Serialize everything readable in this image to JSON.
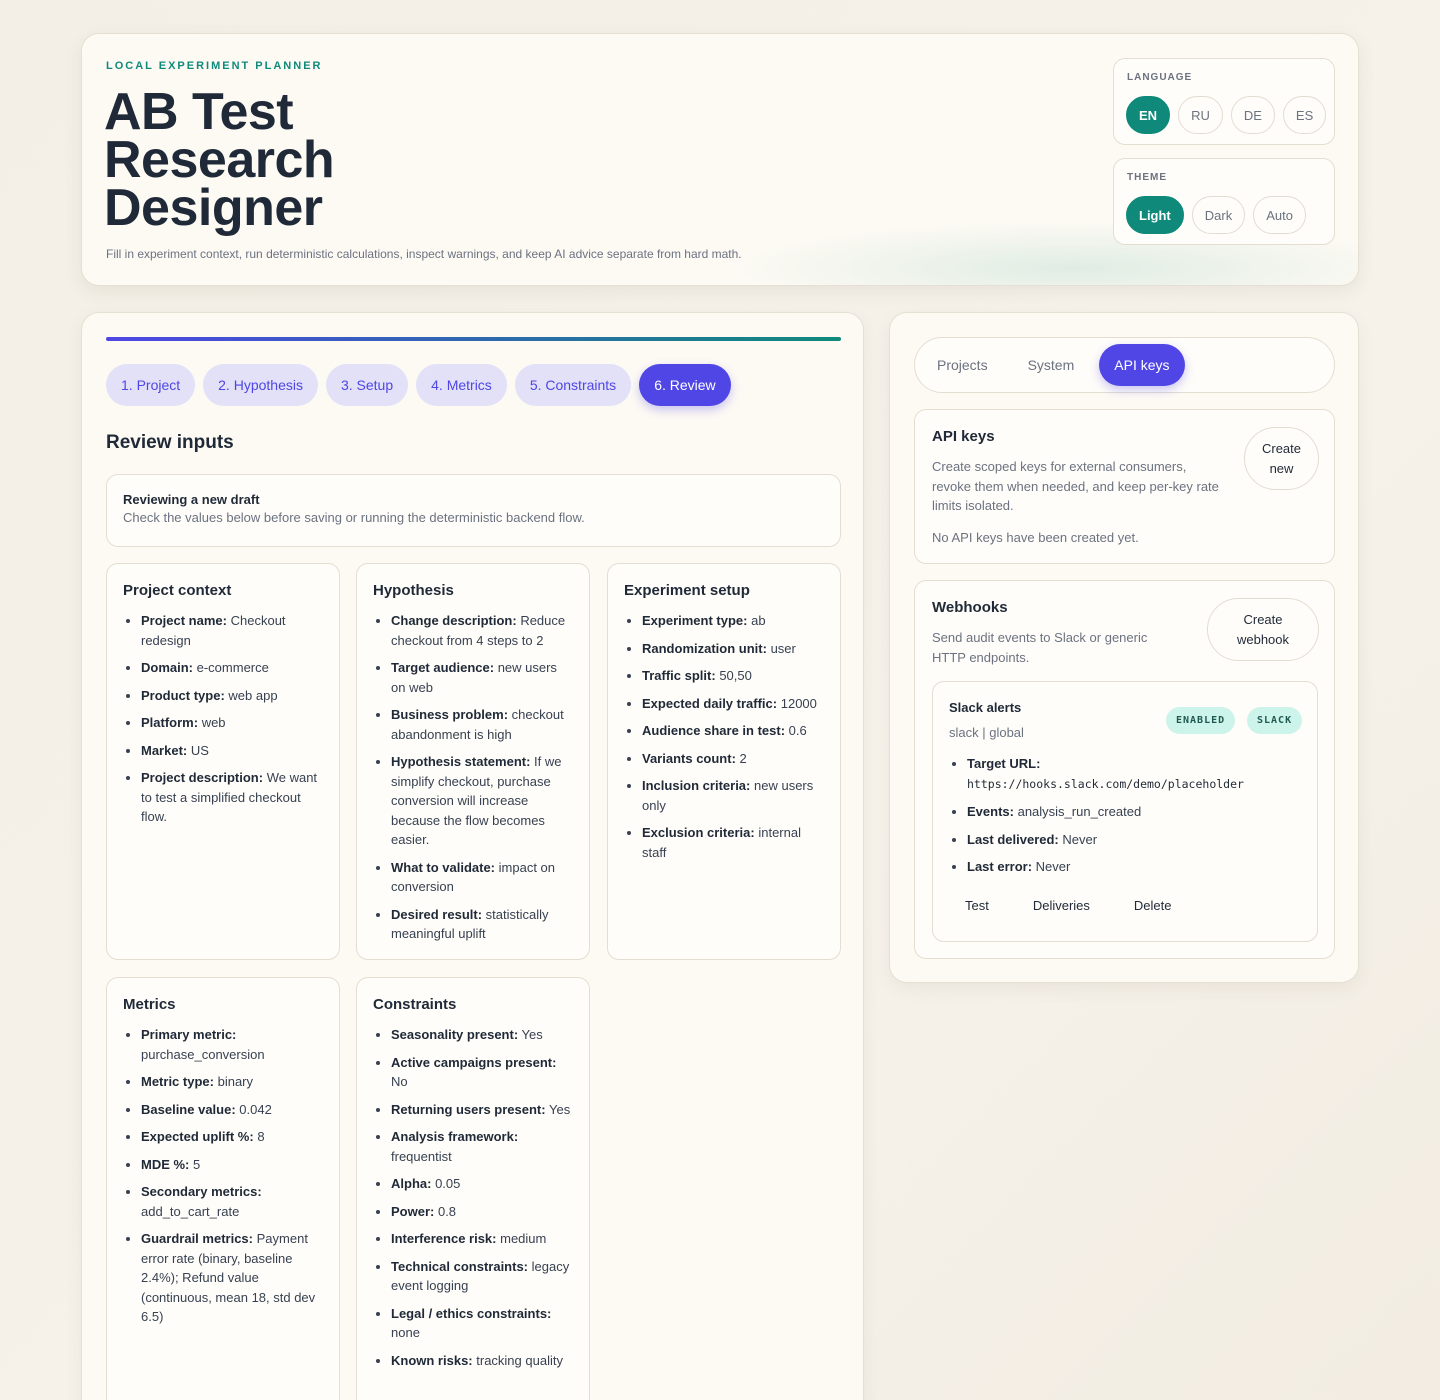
{
  "header": {
    "eyebrow": "LOCAL EXPERIMENT PLANNER",
    "title": "AB Test Research Designer",
    "subtitle": "Fill in experiment context, run deterministic calculations, inspect warnings, and keep AI advice separate from hard math."
  },
  "language": {
    "label": "LANGUAGE",
    "options": [
      "EN",
      "RU",
      "DE",
      "ES"
    ],
    "selected": "EN"
  },
  "theme": {
    "label": "THEME",
    "options": [
      "Light",
      "Dark",
      "Auto"
    ],
    "selected": "Light"
  },
  "wizard": {
    "steps": [
      "1. Project",
      "2. Hypothesis",
      "3. Setup",
      "4. Metrics",
      "5. Constraints",
      "6. Review"
    ],
    "active_step": "6. Review",
    "section_title": "Review inputs",
    "draft_title": "Reviewing a new draft",
    "draft_subtitle": "Check the values below before saving or running the deterministic backend flow.",
    "cards": [
      {
        "title": "Project context",
        "items": [
          {
            "k": "Project name:",
            "v": "Checkout redesign"
          },
          {
            "k": "Domain:",
            "v": "e-commerce"
          },
          {
            "k": "Product type:",
            "v": "web app"
          },
          {
            "k": "Platform:",
            "v": "web"
          },
          {
            "k": "Market:",
            "v": "US"
          },
          {
            "k": "Project description:",
            "v": "We want to test a simplified checkout flow."
          }
        ]
      },
      {
        "title": "Hypothesis",
        "items": [
          {
            "k": "Change description:",
            "v": "Reduce checkout from 4 steps to 2"
          },
          {
            "k": "Target audience:",
            "v": "new users on web"
          },
          {
            "k": "Business problem:",
            "v": "checkout abandonment is high"
          },
          {
            "k": "Hypothesis statement:",
            "v": "If we simplify checkout, purchase conversion will increase because the flow becomes easier."
          },
          {
            "k": "What to validate:",
            "v": "impact on conversion"
          },
          {
            "k": "Desired result:",
            "v": "statistically meaningful uplift"
          }
        ]
      },
      {
        "title": "Experiment setup",
        "items": [
          {
            "k": "Experiment type:",
            "v": "ab"
          },
          {
            "k": "Randomization unit:",
            "v": "user"
          },
          {
            "k": "Traffic split:",
            "v": "50,50"
          },
          {
            "k": "Expected daily traffic:",
            "v": "12000"
          },
          {
            "k": "Audience share in test:",
            "v": "0.6"
          },
          {
            "k": "Variants count:",
            "v": "2"
          },
          {
            "k": "Inclusion criteria:",
            "v": "new users only"
          },
          {
            "k": "Exclusion criteria:",
            "v": "internal staff"
          }
        ]
      },
      {
        "title": "Metrics",
        "items": [
          {
            "k": "Primary metric:",
            "v": "purchase_conversion"
          },
          {
            "k": "Metric type:",
            "v": "binary"
          },
          {
            "k": "Baseline value:",
            "v": "0.042"
          },
          {
            "k": "Expected uplift %:",
            "v": "8"
          },
          {
            "k": "MDE %:",
            "v": "5"
          },
          {
            "k": "Secondary metrics:",
            "v": "add_to_cart_rate"
          },
          {
            "k": "Guardrail metrics:",
            "v": "Payment error rate (binary, baseline 2.4%); Refund value (continuous, mean 18, std dev 6.5)"
          }
        ]
      },
      {
        "title": "Constraints",
        "items": [
          {
            "k": "Seasonality present:",
            "v": "Yes"
          },
          {
            "k": "Active campaigns present:",
            "v": "No"
          },
          {
            "k": "Returning users present:",
            "v": "Yes"
          },
          {
            "k": "Analysis framework:",
            "v": "frequentist"
          },
          {
            "k": "Alpha:",
            "v": "0.05"
          },
          {
            "k": "Power:",
            "v": "0.8"
          },
          {
            "k": "Interference risk:",
            "v": "medium"
          },
          {
            "k": "Technical constraints:",
            "v": "legacy event logging"
          },
          {
            "k": "Legal / ethics constraints:",
            "v": "none"
          },
          {
            "k": "Known risks:",
            "v": "tracking quality"
          }
        ]
      }
    ]
  },
  "sidebar": {
    "tabs": [
      "Projects",
      "System",
      "API keys"
    ],
    "active_tab": "API keys",
    "api_keys": {
      "title": "API keys",
      "description": "Create scoped keys for external consumers, revoke them when needed, and keep per-key rate limits isolated.",
      "empty": "No API keys have been created yet.",
      "create_label": "Create new"
    },
    "webhooks": {
      "title": "Webhooks",
      "description": "Send audit events to Slack or generic HTTP endpoints.",
      "create_label": "Create webhook",
      "item": {
        "name": "Slack alerts",
        "meta": "slack | global",
        "badges": [
          "ENABLED",
          "SLACK"
        ],
        "target_url_label": "Target URL:",
        "target_url": "https://hooks.slack.com/demo/placeholder",
        "events_label": "Events:",
        "events": "analysis_run_created",
        "last_delivered_label": "Last delivered:",
        "last_delivered": "Never",
        "last_error_label": "Last error:",
        "last_error": "Never",
        "actions": [
          "Test",
          "Deliveries",
          "Delete"
        ]
      }
    }
  },
  "colors": {
    "accent_teal": "#0f8a7a",
    "accent_indigo": "#4f46e5",
    "badge_bg": "#ccf4ea"
  }
}
